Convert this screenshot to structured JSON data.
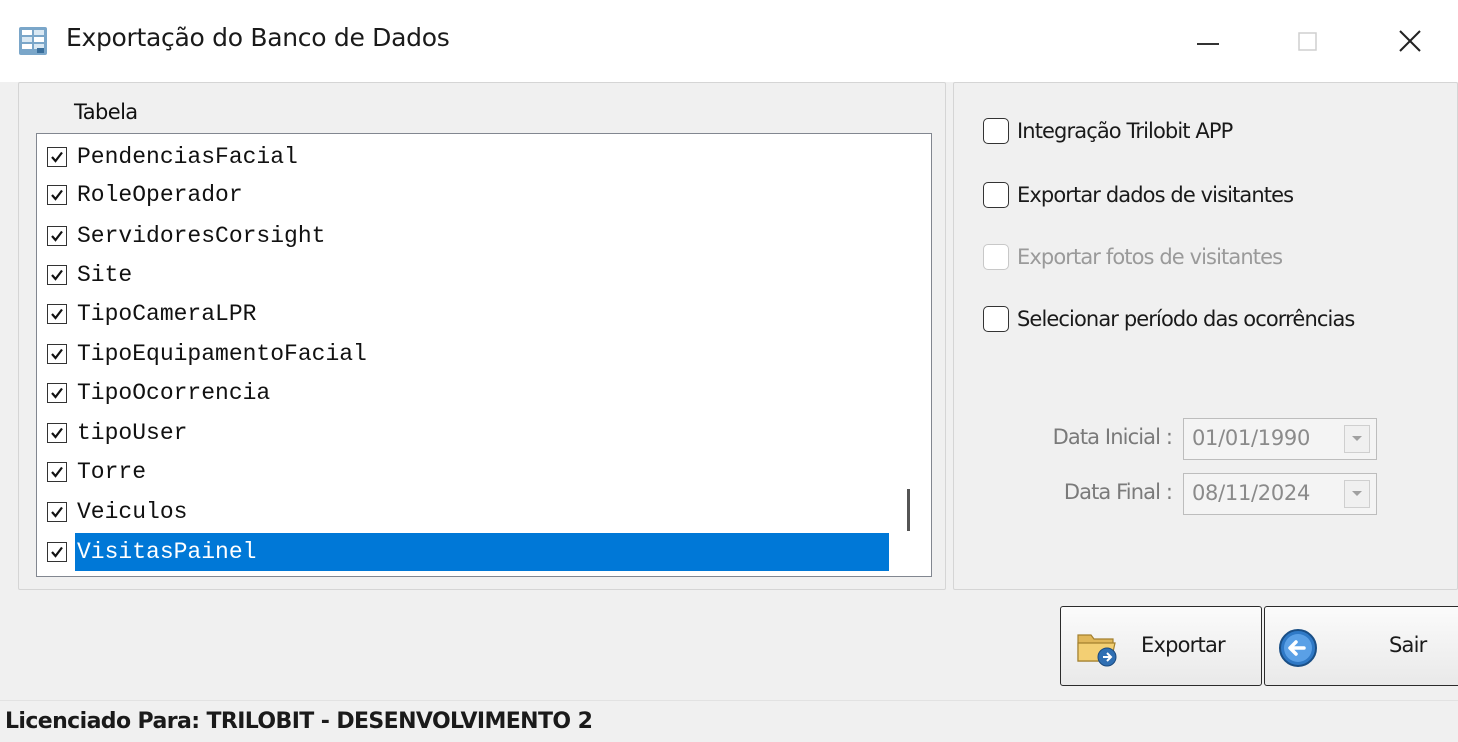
{
  "window": {
    "title": "Exportação do Banco de Dados",
    "icons": {
      "app": "database-export-icon",
      "minimize": "minimize-icon",
      "maximize": "maximize-icon",
      "close": "close-icon"
    }
  },
  "table_panel": {
    "header": "Tabela",
    "items": [
      {
        "label": "PendenciasFacial",
        "checked": true,
        "selected": false
      },
      {
        "label": "RoleOperador",
        "checked": true,
        "selected": false
      },
      {
        "label": "ServidoresCorsight",
        "checked": true,
        "selected": false
      },
      {
        "label": "Site",
        "checked": true,
        "selected": false
      },
      {
        "label": "TipoCameraLPR",
        "checked": true,
        "selected": false
      },
      {
        "label": "TipoEquipamentoFacial",
        "checked": true,
        "selected": false
      },
      {
        "label": "TipoOcorrencia",
        "checked": true,
        "selected": false
      },
      {
        "label": "tipoUser",
        "checked": true,
        "selected": false
      },
      {
        "label": "Torre",
        "checked": true,
        "selected": false
      },
      {
        "label": "Veiculos",
        "checked": true,
        "selected": false
      },
      {
        "label": "VisitasPainel",
        "checked": true,
        "selected": true
      }
    ]
  },
  "options": {
    "integracao": {
      "label": "Integração Trilobit APP",
      "checked": false,
      "enabled": true
    },
    "exportar_dados": {
      "label": "Exportar dados de visitantes",
      "checked": false,
      "enabled": true
    },
    "exportar_fotos": {
      "label": "Exportar fotos de visitantes",
      "checked": false,
      "enabled": false
    },
    "selecionar_periodo": {
      "label": "Selecionar período das ocorrências",
      "checked": false,
      "enabled": true
    }
  },
  "dates": {
    "inicial": {
      "label": "Data Inicial :",
      "value": "01/01/1990",
      "enabled": false
    },
    "final": {
      "label": "Data Final :",
      "value": "08/11/2024",
      "enabled": false
    }
  },
  "buttons": {
    "exportar": {
      "label": "Exportar",
      "icon": "folder-export-icon"
    },
    "sair": {
      "label": "Sair",
      "icon": "exit-circle-arrow-icon"
    }
  },
  "status": {
    "text": "Licenciado Para: TRILOBIT - DESENVOLVIMENTO 2"
  },
  "colors": {
    "selection": "#0078d7",
    "window_bg": "#f0f0f0",
    "titlebar_bg": "#ffffff",
    "disabled_text": "#9a9a9a"
  }
}
